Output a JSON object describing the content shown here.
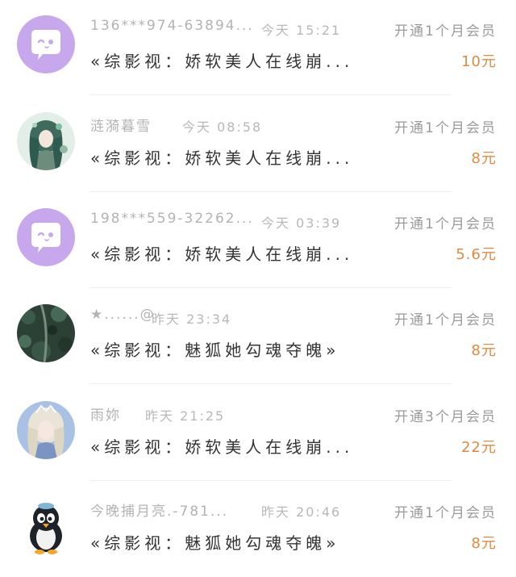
{
  "records": [
    {
      "user": "136***974-63894...",
      "time": "今天 15:21",
      "plan": "开通1个月会员",
      "book": "«综影视：娇软美人在线崩...",
      "amount": "10元",
      "avatar": "wechat-default-avatar-icon"
    },
    {
      "user": "涟漪暮雪",
      "time": "今天 08:58",
      "plan": "开通1个月会员",
      "book": "«综影视：娇软美人在线崩...",
      "amount": "8元",
      "avatar": "anime-girl-avatar"
    },
    {
      "user": "198***559-32262...",
      "time": "今天 03:39",
      "plan": "开通1个月会员",
      "book": "«综影视：娇软美人在线崩...",
      "amount": "5.6元",
      "avatar": "wechat-default-avatar-icon"
    },
    {
      "user": "★......@",
      "time": "昨天 23:34",
      "plan": "开通1个月会员",
      "book": "«综影视：魅狐她勾魂夺魄»",
      "amount": "8元",
      "avatar": "aerial-forest-avatar"
    },
    {
      "user": "雨妳",
      "time": "昨天 21:25",
      "plan": "开通3个月会员",
      "book": "«综影视：娇软美人在线崩...",
      "amount": "22元",
      "avatar": "fantasy-girl-avatar"
    },
    {
      "user": "今晚捕月亮.-781...",
      "time": "昨天 20:46",
      "plan": "开通1个月会员",
      "book": "«综影视：魅狐她勾魂夺魄»",
      "amount": "8元",
      "avatar": "penguin-avatar"
    }
  ],
  "colors": {
    "amount": "#e08a42",
    "meta": "#b3b3b3",
    "plan": "#9a9a9a",
    "title": "#333333",
    "default_avatar_bg": "#c8a8ec"
  }
}
